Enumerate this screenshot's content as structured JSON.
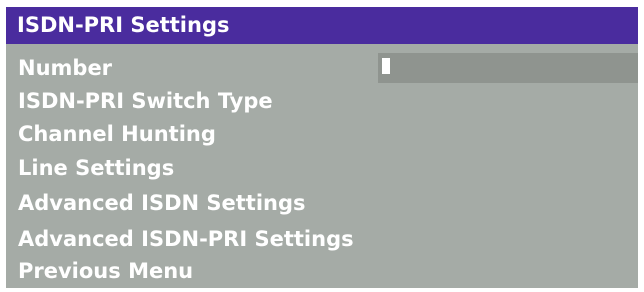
{
  "window": {
    "title": "ISDN-PRI Settings"
  },
  "menu": {
    "items": [
      {
        "label": "Number"
      },
      {
        "label": "ISDN-PRI Switch Type"
      },
      {
        "label": "Channel Hunting"
      },
      {
        "label": "Line Settings"
      },
      {
        "label": "Advanced ISDN Settings"
      },
      {
        "label": "Advanced ISDN-PRI Settings"
      },
      {
        "label": "Previous Menu"
      }
    ]
  },
  "number_field": {
    "value": ""
  },
  "colors": {
    "title_bar": "#4a2c9e",
    "panel": "#a5aba6",
    "input": "#8f948f",
    "text": "#ffffff"
  }
}
